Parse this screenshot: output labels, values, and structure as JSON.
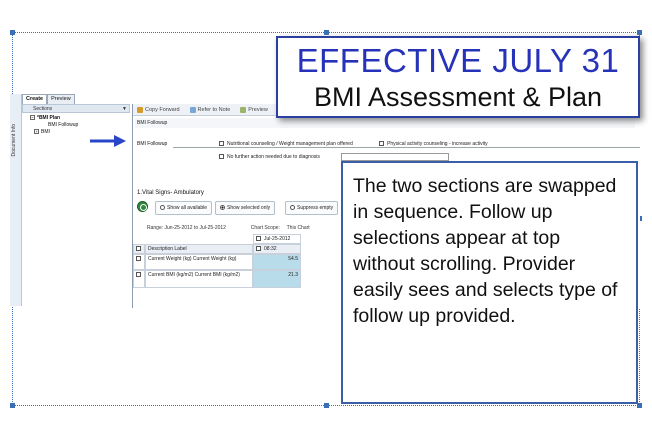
{
  "banner": {
    "headline": "EFFECTIVE JULY 31",
    "subhead": "BMI Assessment & Plan"
  },
  "callout_text": "The two sections are swapped in sequence.  Follow up selections appear at top without scrolling.  Provider easily sees and selects type of follow up provided.",
  "app": {
    "side_strip_label": "Document Info",
    "tabs": [
      {
        "label": "Create",
        "active": true
      },
      {
        "label": "Preview",
        "active": false
      }
    ],
    "sections_label": "Sections",
    "pin_icon": "pin-icon",
    "tree": [
      {
        "label": "*BMI Plan",
        "level": 1
      },
      {
        "label": "BMI Followup",
        "level": 2
      },
      {
        "label": "BMI",
        "level": 3
      }
    ],
    "toolbar": [
      {
        "label": "Copy Forward",
        "icon": "copy-icon"
      },
      {
        "label": "Refer to Note",
        "icon": "note-icon"
      },
      {
        "label": "Preview",
        "icon": "preview-icon"
      }
    ],
    "section_header": "BMI Followup",
    "bmi_followup_label": "BMI Followup",
    "options": {
      "nutritional": "Nutritional counseling / Weight management plan offered",
      "physical": "Physical activity counseling - increase activity",
      "no_further": "No further action needed due to diagnosis"
    },
    "vitals": {
      "title": "1.Vital Signs- Ambulatory",
      "radio_show_all": "Show all available",
      "radio_show_selected": "Show selected only",
      "radio_suppress": "Suppress empty",
      "range": "Range:  Jun-25-2012 to Jul-25-2012",
      "chart_scope": "Chart Scope:",
      "this_chart": "This Chart",
      "date": "Jul-25-2012",
      "time": "08:32",
      "desc_header": "Description Label",
      "rows": [
        {
          "label": "Current Weight (kg) Current Weight (kg)",
          "value": "54.5"
        },
        {
          "label": "Current BMI (kg/m2) Current BMI (kg/m2)",
          "value": "21.3"
        }
      ]
    }
  },
  "colors": {
    "headline_blue": "#2633b8",
    "frame_blue": "#3a5fa8",
    "arrow_blue": "#2a46c8",
    "value_cell": "#b9dcea"
  }
}
